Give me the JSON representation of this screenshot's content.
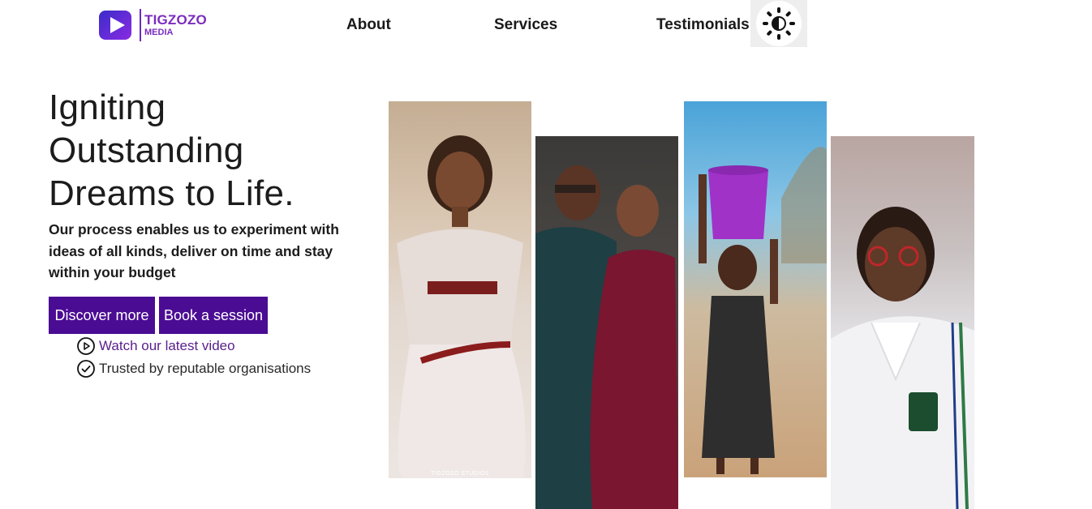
{
  "header": {
    "logo": {
      "name": "TIGZOZO",
      "sub": "MEDIA"
    },
    "nav": [
      {
        "label": "About"
      },
      {
        "label": "Services"
      },
      {
        "label": "Testimonials"
      }
    ],
    "theme_toggle_icon": "sun-moon-icon"
  },
  "hero": {
    "title": "Igniting Outstanding Dreams to Life.",
    "subtitle": "Our process enables us to experiment with ideas of all kinds, deliver on time and stay within your budget",
    "buttons": {
      "discover": "Discover more",
      "book": "Book a session"
    },
    "video_link": "Watch our latest video",
    "trusted": "Trusted by reputable organisations",
    "accent_color": "#4b0c94"
  },
  "gallery": {
    "watermark": "TIGZOZO STUDIOS"
  }
}
